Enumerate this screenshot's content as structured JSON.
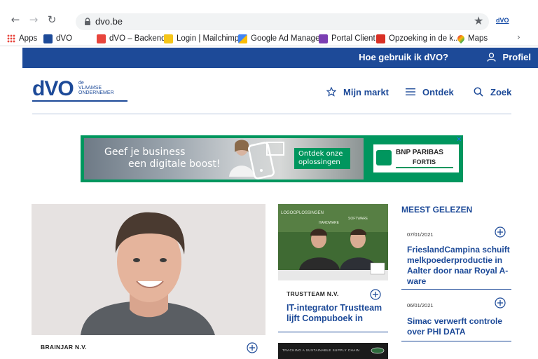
{
  "browser": {
    "url": "dvo.be",
    "bookmarks": [
      {
        "label": "Apps",
        "icon": "apps-grid-icon",
        "color": "#e8453c"
      },
      {
        "label": "dVO",
        "icon": "dvo-favicon",
        "color": "#1d4a98"
      },
      {
        "label": "dVO – Backend",
        "icon": "backend-favicon",
        "color": "#e8453c"
      },
      {
        "label": "Login | Mailchimp",
        "icon": "mailchimp-icon",
        "color": "#f5c518"
      },
      {
        "label": "Google Ad Manager",
        "icon": "ad-manager-icon",
        "color": "#4285f4"
      },
      {
        "label": "Portal Client",
        "icon": "portal-icon",
        "color": "#7b3fb3"
      },
      {
        "label": "Opzoeking in de k...",
        "icon": "kbo-icon",
        "color": "#d93025"
      },
      {
        "label": "Maps",
        "icon": "maps-pin-icon",
        "color": "#34a853"
      }
    ],
    "extension_label": "dVO"
  },
  "topbar": {
    "help_label": "Hoe gebruik ik dVO?",
    "profile_label": "Profiel"
  },
  "logo": {
    "text": "dVO",
    "subtext_line1": "de",
    "subtext_line2": "VLAAMSE",
    "subtext_line3": "ONDERNEMER"
  },
  "nav": {
    "market_label": "Mijn markt",
    "discover_label": "Ontdek",
    "search_label": "Zoek"
  },
  "banner": {
    "headline_line1": "Geef je business",
    "headline_line2": "een digitale boost!",
    "cta_line1": "Ontdek onze",
    "cta_line2": "oplossingen",
    "brand_name": "BNP PARIBAS",
    "brand_sub": "FORTIS",
    "close_label": "✕",
    "accent_color": "#00965e"
  },
  "articles": {
    "hero": {
      "company": "BRAINJAR N.V."
    },
    "middle": {
      "image_words": [
        "LOGOOPLOSSINGEN",
        "HARDWARE",
        "SOFTWARE"
      ],
      "company": "TRUSTTEAM N.V.",
      "title": "IT-integrator Trustteam lijft Compuboek in",
      "next_caption": "TRACKING A SUSTAINABLE SUPPLY CHAIN"
    }
  },
  "sidebar": {
    "title": "MEEST GELEZEN",
    "items": [
      {
        "date": "07/01/2021",
        "title": "FrieslandCampina schuift melkpoederproductie in Aalter door naar Royal A-ware"
      },
      {
        "date": "06/01/2021",
        "title": "Simac verwerft controle over PHI DATA"
      }
    ]
  },
  "colors": {
    "brand_blue": "#1d4a98",
    "divider": "#b7c6de"
  }
}
